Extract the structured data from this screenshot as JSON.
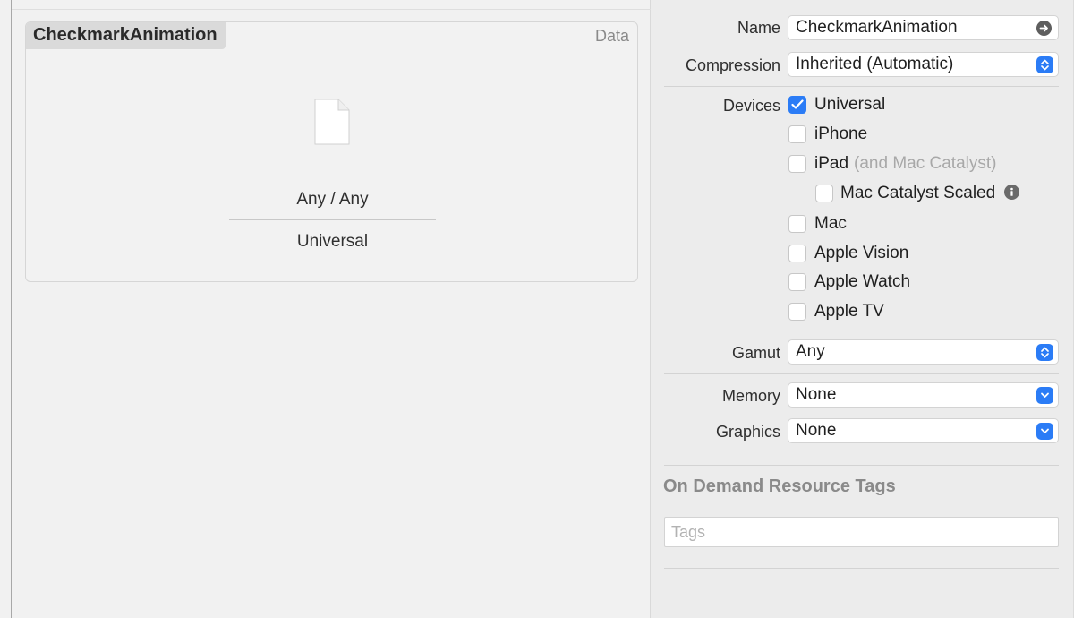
{
  "asset": {
    "name": "CheckmarkAnimation",
    "type": "Data",
    "icon": "document-icon",
    "slot_appearance": "Any / Any",
    "slot_device": "Universal"
  },
  "inspector": {
    "name_label": "Name",
    "name_value": "CheckmarkAnimation",
    "compression_label": "Compression",
    "compression_value": "Inherited (Automatic)",
    "devices_label": "Devices",
    "devices": [
      {
        "label": "Universal",
        "checked": true
      },
      {
        "label": "iPhone",
        "checked": false
      },
      {
        "label": "iPad",
        "note": "(and Mac Catalyst)",
        "checked": false
      },
      {
        "label": "Mac Catalyst Scaled",
        "checked": false
      },
      {
        "label": "Mac",
        "checked": false
      },
      {
        "label": "Apple Vision",
        "checked": false
      },
      {
        "label": "Apple Watch",
        "checked": false
      },
      {
        "label": "Apple TV",
        "checked": false
      }
    ],
    "gamut_label": "Gamut",
    "gamut_value": "Any",
    "memory_label": "Memory",
    "memory_value": "None",
    "graphics_label": "Graphics",
    "graphics_value": "None",
    "odr_title": "On Demand Resource Tags",
    "tags_placeholder": "Tags"
  },
  "colors": {
    "accent": "#2b7cf6",
    "editor_bg": "#f1f1f1",
    "inspector_bg": "#ececec"
  }
}
